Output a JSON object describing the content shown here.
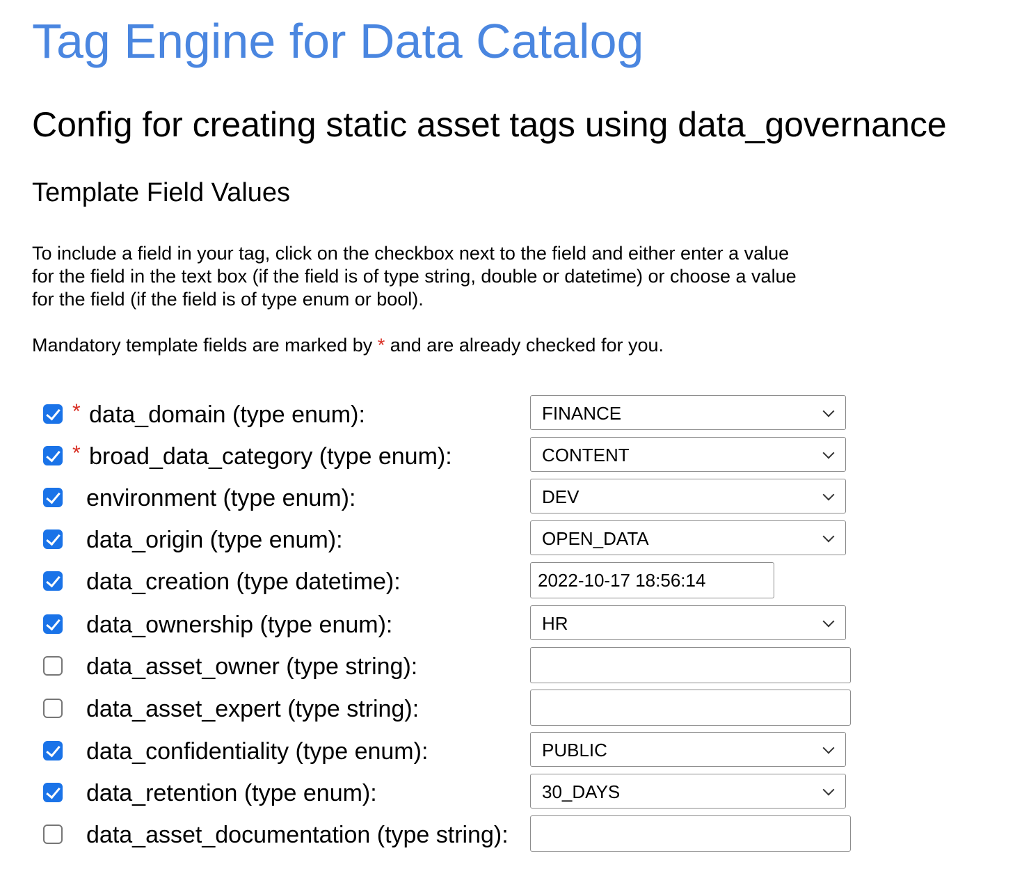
{
  "header": {
    "app_title": "Tag Engine for Data Catalog",
    "config_title": "Config for creating static asset tags using data_governance",
    "section_title": "Template Field Values"
  },
  "instructions": {
    "text": "To include a field in your tag, click on the checkbox next to the field and either enter a value for the field in the text box (if the field is of type string, double or datetime) or choose a value for the field (if the field is of type enum or bool).",
    "mandatory_prefix": "Mandatory template fields are marked by ",
    "mandatory_star": "*",
    "mandatory_suffix": " and are already checked for you."
  },
  "colors": {
    "title_blue": "#4a86e0",
    "checkbox_blue": "#1a73e8",
    "required_red": "#d93025"
  },
  "fields": [
    {
      "label": "data_domain (type enum):",
      "required": true,
      "checked": true,
      "control": "select",
      "value": "FINANCE"
    },
    {
      "label": "broad_data_category (type enum):",
      "required": true,
      "checked": true,
      "control": "select",
      "value": "CONTENT"
    },
    {
      "label": "environment (type enum):",
      "required": false,
      "checked": true,
      "control": "select",
      "value": "DEV"
    },
    {
      "label": "data_origin (type enum):",
      "required": false,
      "checked": true,
      "control": "select",
      "value": "OPEN_DATA"
    },
    {
      "label": "data_creation (type datetime):",
      "required": false,
      "checked": true,
      "control": "text",
      "value": "2022-10-17 18:56:14"
    },
    {
      "label": "data_ownership (type enum):",
      "required": false,
      "checked": true,
      "control": "select",
      "value": "HR"
    },
    {
      "label": "data_asset_owner (type string):",
      "required": false,
      "checked": false,
      "control": "text",
      "value": ""
    },
    {
      "label": "data_asset_expert (type string):",
      "required": false,
      "checked": false,
      "control": "text",
      "value": ""
    },
    {
      "label": "data_confidentiality (type enum):",
      "required": false,
      "checked": true,
      "control": "select",
      "value": "PUBLIC"
    },
    {
      "label": "data_retention (type enum):",
      "required": false,
      "checked": true,
      "control": "select",
      "value": "30_DAYS"
    },
    {
      "label": "data_asset_documentation (type string):",
      "required": false,
      "checked": false,
      "control": "text",
      "value": ""
    }
  ]
}
